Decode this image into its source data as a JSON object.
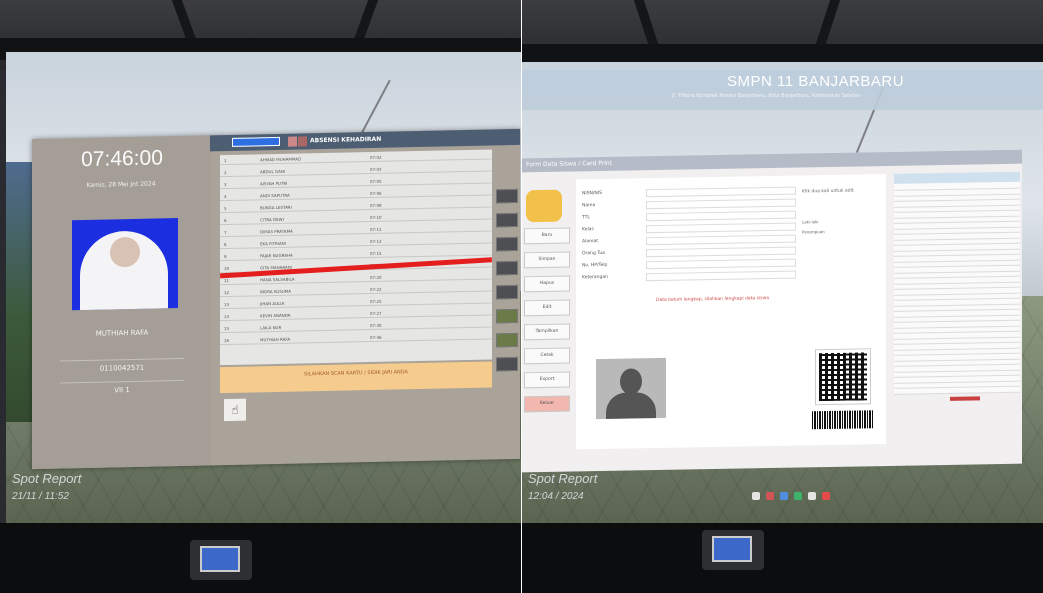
{
  "left_photo": {
    "attendance_app": {
      "clock": "07:46:00",
      "date": "Kamis, 28 Mei Jnt 2024",
      "student_name": "MUTHIAH RAFA",
      "student_id": "0110042571",
      "student_class": "VII 1",
      "window_title": "ABSENSI KEHADIRAN",
      "notice": "SILAHKAN SCAN KARTU / SIDIK JARI ANDA",
      "fingerprint_icon": "fingerprint-icon",
      "list_rows": [
        {
          "no": "1",
          "name": "AHMAD MUHAMMAD",
          "time": "07:02"
        },
        {
          "no": "2",
          "name": "ABDUL GANI",
          "time": "07:03"
        },
        {
          "no": "3",
          "name": "AISYAH PUTRI",
          "time": "07:05"
        },
        {
          "no": "4",
          "name": "ANDI SAPUTRA",
          "time": "07:06"
        },
        {
          "no": "5",
          "name": "BUNGA LESTARI",
          "time": "07:08"
        },
        {
          "no": "6",
          "name": "CITRA DEWI",
          "time": "07:10"
        },
        {
          "no": "7",
          "name": "DIMAS PRATAMA",
          "time": "07:11"
        },
        {
          "no": "8",
          "name": "EKA FITRIANI",
          "time": "07:13"
        },
        {
          "no": "9",
          "name": "FAJAR NUGRAHA",
          "time": "07:15"
        },
        {
          "no": "10",
          "name": "GITA MAHARANI",
          "time": "07:18"
        },
        {
          "no": "11",
          "name": "HANA SALSABILA",
          "time": "07:20"
        },
        {
          "no": "12",
          "name": "INDRA KUSUMA",
          "time": "07:22"
        },
        {
          "no": "13",
          "name": "JIHAN AULIA",
          "time": "07:25"
        },
        {
          "no": "14",
          "name": "KEVIN ANANDA",
          "time": "07:27"
        },
        {
          "no": "15",
          "name": "LAILA NUR",
          "time": "07:30"
        },
        {
          "no": "16",
          "name": "MUTHIAH RAFA",
          "time": "07:46"
        }
      ],
      "right_buttons": [
        "",
        "",
        "",
        "",
        "",
        "",
        "",
        ""
      ]
    },
    "wallpaper_caption": "Spot Report",
    "wallpaper_caption_sub": "21/11 / 11:52"
  },
  "right_photo": {
    "banner": {
      "school": "SMPN 11 BANJARBARU",
      "address": "Jl. Trikora Komplek Pemko Banjarbaru, Kota Banjarbaru, Kalimantan Selatan"
    },
    "registration_app": {
      "window_title": "Form Data Siswa / Card Print",
      "menu": [
        "Baru",
        "Simpan",
        "Hapus",
        "Edit",
        "Tampilkan",
        "Cetak",
        "Export",
        "Keluar"
      ],
      "form_labels": [
        "NISN/NIS",
        "Nama",
        "TTL",
        "Kelas",
        "Alamat",
        "Orang Tua",
        "No. HP/Telp",
        "Keterangan"
      ],
      "right_note": "Klik dua kali untuk edit",
      "radio_options": [
        "Laki-laki",
        "Perempuan"
      ],
      "warning": "Data belum lengkap, silahkan lengkapi data siswa"
    },
    "wallpaper_caption": "Spot Report",
    "wallpaper_caption_sub": "12:04 / 2024"
  }
}
